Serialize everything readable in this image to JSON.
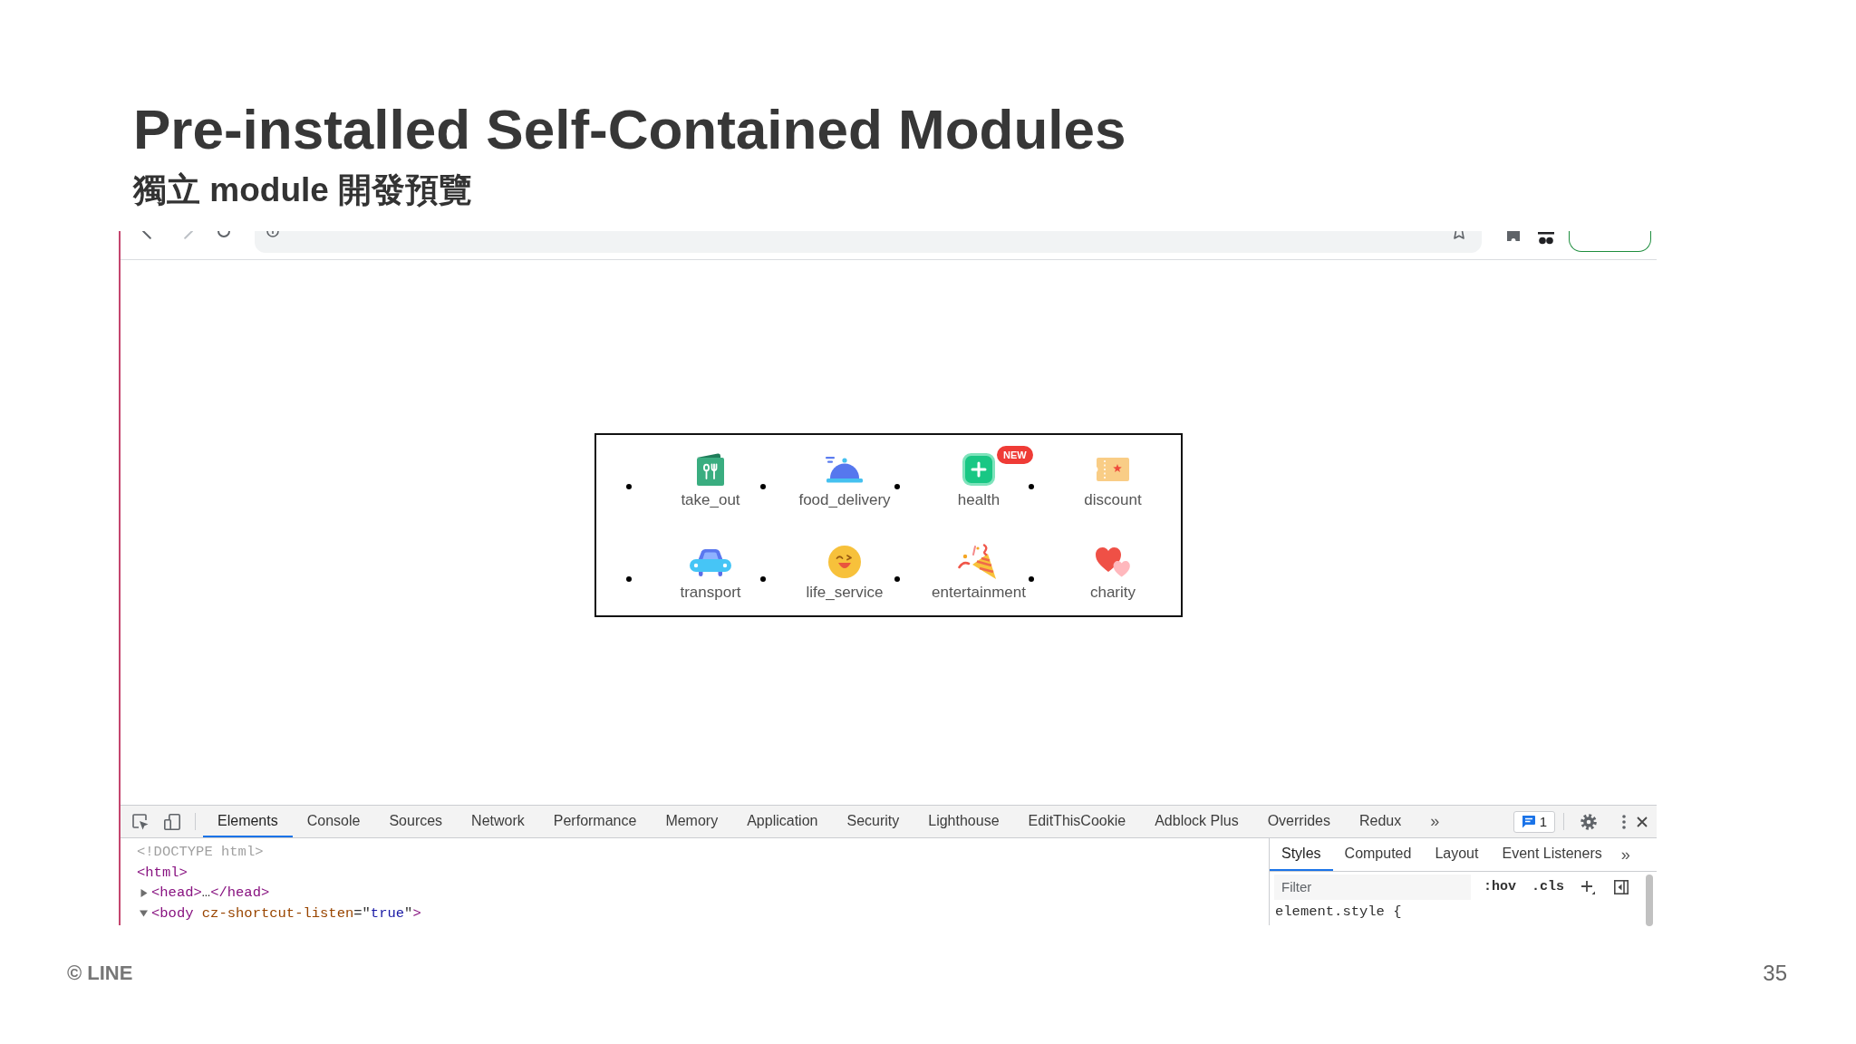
{
  "slide": {
    "title": "Pre-installed Self-Contained Modules",
    "subtitle": "獨立 module 開發預覽"
  },
  "preview": {
    "modules": [
      {
        "label": "take_out"
      },
      {
        "label": "food_delivery"
      },
      {
        "label": "health",
        "badge": "NEW"
      },
      {
        "label": "discount"
      },
      {
        "label": "transport"
      },
      {
        "label": "life_service"
      },
      {
        "label": "entertainment"
      },
      {
        "label": "charity"
      }
    ]
  },
  "devtools": {
    "tabs": [
      {
        "label": "Elements",
        "selected": true
      },
      {
        "label": "Console",
        "selected": false
      },
      {
        "label": "Sources",
        "selected": false
      },
      {
        "label": "Network",
        "selected": false
      },
      {
        "label": "Performance",
        "selected": false
      },
      {
        "label": "Memory",
        "selected": false
      },
      {
        "label": "Application",
        "selected": false
      },
      {
        "label": "Security",
        "selected": false
      },
      {
        "label": "Lighthouse",
        "selected": false
      },
      {
        "label": "EditThisCookie",
        "selected": false
      },
      {
        "label": "Adblock Plus",
        "selected": false
      },
      {
        "label": "Overrides",
        "selected": false
      },
      {
        "label": "Redux",
        "selected": false
      }
    ],
    "more_tabs": "»",
    "issues_count": "1",
    "dom_tree": [
      {
        "tokens": [
          {
            "kind": "doctype",
            "text": "<!DOCTYPE html>"
          }
        ]
      },
      {
        "tokens": [
          {
            "kind": "tag",
            "text": "<html>"
          }
        ],
        "children": [
          {
            "expanded": false,
            "tokens": [
              {
                "kind": "tag",
                "text": "<head>"
              },
              {
                "kind": "plain",
                "text": "…"
              },
              {
                "kind": "tag",
                "text": "</head>"
              }
            ]
          },
          {
            "expanded": true,
            "tokens": [
              {
                "kind": "tag",
                "text": "<body"
              },
              {
                "kind": "attr",
                "text": " cz-shortcut-listen"
              },
              {
                "kind": "plain",
                "text": "=\""
              },
              {
                "kind": "value",
                "text": "true"
              },
              {
                "kind": "plain",
                "text": "\""
              },
              {
                "kind": "tag",
                "text": ">"
              }
            ]
          }
        ]
      }
    ],
    "sidebar": {
      "tabs": [
        {
          "label": "Styles",
          "selected": true
        },
        {
          "label": "Computed",
          "selected": false
        },
        {
          "label": "Layout",
          "selected": false
        },
        {
          "label": "Event Listeners",
          "selected": false
        }
      ],
      "more_tabs": "»",
      "filter": {
        "placeholder": "Filter"
      },
      "hov": ":hov",
      "cls": ".cls",
      "rule": "element.style {"
    }
  },
  "footer": {
    "copyright": "© LINE",
    "page_number": "35"
  }
}
